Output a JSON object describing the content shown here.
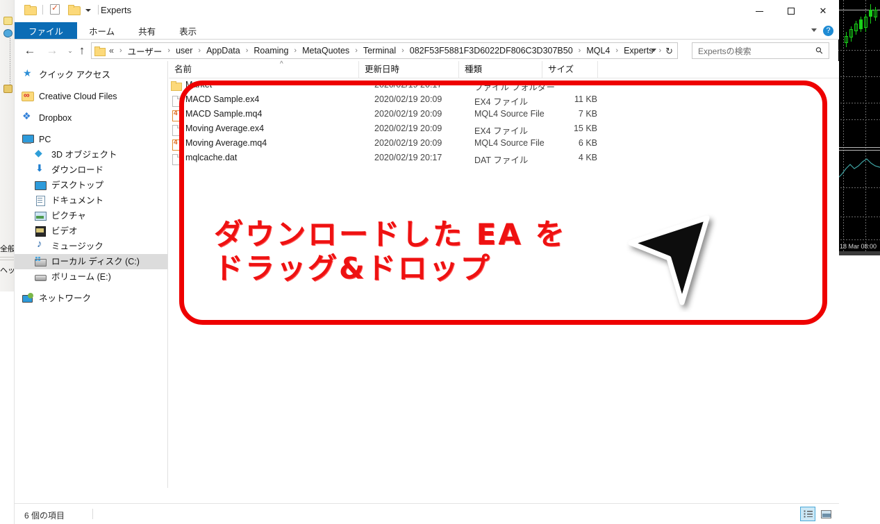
{
  "window": {
    "title": "Experts",
    "quick_access": [
      "folder-icon",
      "properties-icon",
      "new-folder-icon",
      "customize-caret-icon"
    ],
    "controls": {
      "minimize": "—",
      "maximize": "□",
      "close": "✕"
    }
  },
  "ribbon": {
    "tabs": [
      {
        "label": "ファイル",
        "active": true
      },
      {
        "label": "ホーム",
        "active": false
      },
      {
        "label": "共有",
        "active": false
      },
      {
        "label": "表示",
        "active": false
      }
    ],
    "help_label": "?"
  },
  "address": {
    "back": "←",
    "forward": "→",
    "recent": "⌄",
    "up": "↑",
    "root_prefix": "«",
    "crumbs": [
      "ユーザー",
      "user",
      "AppData",
      "Roaming",
      "MetaQuotes",
      "Terminal",
      "082F53F5881F3D6022DF806C3D307B50",
      "MQL4",
      "Experts"
    ],
    "separator": "›",
    "dropdown": "⌄",
    "refresh": "↻"
  },
  "search": {
    "placeholder": "Expertsの検索",
    "icon": "search-icon"
  },
  "sidebar": {
    "items": [
      {
        "label": "クイック アクセス",
        "icon": "star-icon",
        "indent": 0,
        "selected": false
      },
      {
        "label": "Creative Cloud Files",
        "icon": "creative-cloud-icon",
        "indent": 0,
        "selected": false
      },
      {
        "label": "Dropbox",
        "icon": "dropbox-icon",
        "indent": 0,
        "selected": false
      },
      {
        "label": "PC",
        "icon": "pc-icon",
        "indent": 0,
        "selected": false
      },
      {
        "label": "3D オブジェクト",
        "icon": "3d-objects-icon",
        "indent": 1,
        "selected": false
      },
      {
        "label": "ダウンロード",
        "icon": "downloads-icon",
        "indent": 1,
        "selected": false
      },
      {
        "label": "デスクトップ",
        "icon": "desktop-icon",
        "indent": 1,
        "selected": false
      },
      {
        "label": "ドキュメント",
        "icon": "documents-icon",
        "indent": 1,
        "selected": false
      },
      {
        "label": "ピクチャ",
        "icon": "pictures-icon",
        "indent": 1,
        "selected": false
      },
      {
        "label": "ビデオ",
        "icon": "videos-icon",
        "indent": 1,
        "selected": false
      },
      {
        "label": "ミュージック",
        "icon": "music-icon",
        "indent": 1,
        "selected": false
      },
      {
        "label": "ローカル ディスク (C:)",
        "icon": "local-disk-icon",
        "indent": 1,
        "selected": true
      },
      {
        "label": "ボリューム (E:)",
        "icon": "volume-disk-icon",
        "indent": 1,
        "selected": false
      },
      {
        "label": "ネットワーク",
        "icon": "network-icon",
        "indent": 0,
        "selected": false
      }
    ]
  },
  "filelist": {
    "columns": [
      "名前",
      "更新日時",
      "種類",
      "サイズ"
    ],
    "sort_indicator": "^",
    "rows": [
      {
        "name": "Market",
        "date": "2020/02/19 20:17",
        "type": "ファイル フォルダー",
        "size": "",
        "icon": "folder-icon"
      },
      {
        "name": "MACD Sample.ex4",
        "date": "2020/02/19 20:09",
        "type": "EX4 ファイル",
        "size": "11 KB",
        "icon": "file-icon"
      },
      {
        "name": "MACD Sample.mq4",
        "date": "2020/02/19 20:09",
        "type": "MQL4 Source File",
        "size": "7 KB",
        "icon": "mq4-icon"
      },
      {
        "name": "Moving Average.ex4",
        "date": "2020/02/19 20:09",
        "type": "EX4 ファイル",
        "size": "15 KB",
        "icon": "file-icon"
      },
      {
        "name": "Moving Average.mq4",
        "date": "2020/02/19 20:09",
        "type": "MQL4 Source File",
        "size": "6 KB",
        "icon": "mq4-icon"
      },
      {
        "name": "mqlcache.dat",
        "date": "2020/02/19 20:17",
        "type": "DAT ファイル",
        "size": "4 KB",
        "icon": "file-icon"
      }
    ]
  },
  "statusbar": {
    "item_count": "6 個の項目",
    "view_details_label": "details-view",
    "view_large_icons_label": "large-icons-view"
  },
  "annotation": {
    "text": "ダウンロードした EA を\nドラッグ&ドロップ",
    "color": "#ee1111",
    "box_color": "#ee0000",
    "cursor": "drag-drop-cursor"
  },
  "background_app": {
    "left_panel_labels": [
      "全般",
      "ヘッ"
    ],
    "chart_time_label": "18 Mar 08:00",
    "chart_bg": "#000000",
    "candle_color": "#19d219"
  }
}
